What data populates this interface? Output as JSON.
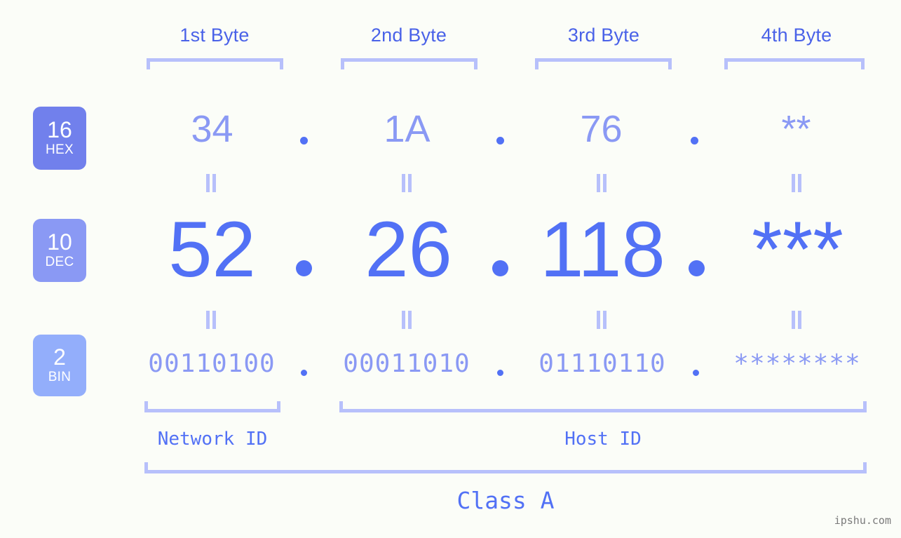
{
  "meta": {
    "background_color": "#fbfdf8",
    "accent_strong": "#5271f5",
    "accent_mid": "#8a99f4",
    "accent_light": "#b7c0fb",
    "watermark": "ipshu.com"
  },
  "byte_headers": [
    {
      "label": "1st Byte"
    },
    {
      "label": "2nd Byte"
    },
    {
      "label": "3rd Byte"
    },
    {
      "label": "4th Byte"
    }
  ],
  "bases": [
    {
      "number": "16",
      "abbr": "HEX",
      "color": "#7180ec"
    },
    {
      "number": "10",
      "abbr": "DEC",
      "color": "#8a99f4"
    },
    {
      "number": "2",
      "abbr": "BIN",
      "color": "#93aefb"
    }
  ],
  "rows": {
    "hex": {
      "values": [
        "34",
        "1A",
        "76",
        "**"
      ]
    },
    "dec": {
      "values": [
        "52",
        "26",
        "118",
        "***"
      ]
    },
    "bin": {
      "values": [
        "00110100",
        "00011010",
        "01110110",
        "********"
      ]
    }
  },
  "separators": {
    "symbol": "."
  },
  "equality": {
    "symbol": "="
  },
  "segments": {
    "network_id": "Network ID",
    "host_id": "Host ID"
  },
  "class": {
    "label": "Class A"
  },
  "chart_data": {
    "type": "table",
    "title": "Class A IP address byte breakdown",
    "columns": [
      "1st Byte",
      "2nd Byte",
      "3rd Byte",
      "4th Byte"
    ],
    "rows": [
      {
        "base": "HEX",
        "radix": 16,
        "values": [
          "34",
          "1A",
          "76",
          "**"
        ]
      },
      {
        "base": "DEC",
        "radix": 10,
        "values": [
          "52",
          "26",
          "118",
          "***"
        ]
      },
      {
        "base": "BIN",
        "radix": 2,
        "values": [
          "00110100",
          "00011010",
          "01110110",
          "********"
        ]
      }
    ],
    "network_id_bytes": 1,
    "host_id_bytes": 3,
    "class": "Class A"
  }
}
